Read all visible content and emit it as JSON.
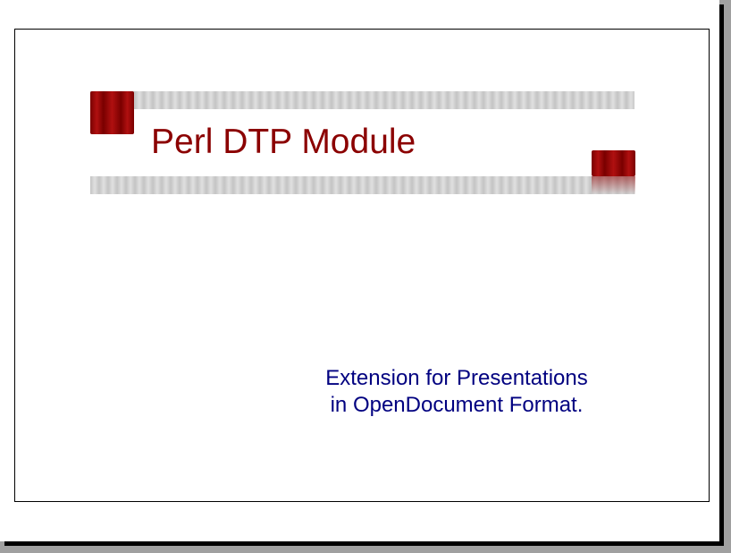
{
  "slide": {
    "title": "Perl DTP Module",
    "subtitle_line1": "Extension for Presentations",
    "subtitle_line2": "in OpenDocument Format."
  },
  "colors": {
    "background": "#a0a0a0",
    "page": "#ffffff",
    "title": "#8b0000",
    "subtitle": "#000080",
    "accent_red": "#8b0000",
    "bar_gray": "#cccccc"
  }
}
